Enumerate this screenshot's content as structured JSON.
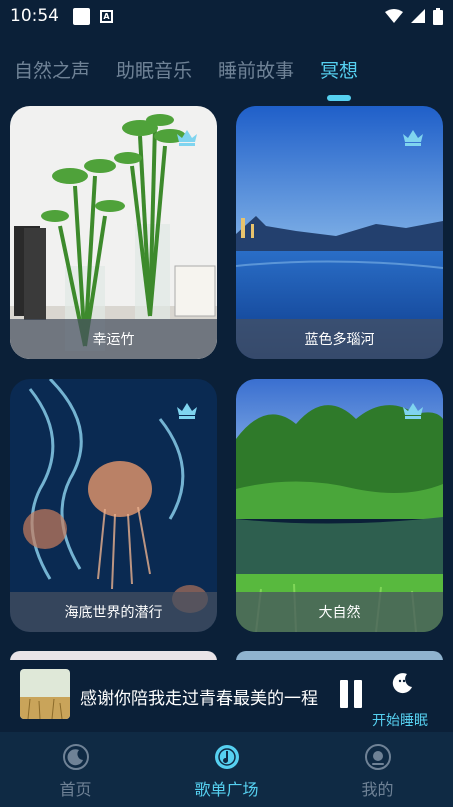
{
  "status_bar": {
    "time": "10:54"
  },
  "tabs": [
    {
      "label": "自然之声",
      "active": false
    },
    {
      "label": "助眠音乐",
      "active": false
    },
    {
      "label": "睡前故事",
      "active": false
    },
    {
      "label": "冥想",
      "active": true
    }
  ],
  "cards": [
    {
      "label": "幸运竹",
      "premium": true
    },
    {
      "label": "蓝色多瑙河",
      "premium": true
    },
    {
      "label": "海底世界的潜行",
      "premium": true
    },
    {
      "label": "大自然",
      "premium": true
    }
  ],
  "player": {
    "song_title": "感谢你陪我走过青春最美的一程",
    "sleep_label": "开始睡眠"
  },
  "bottom_nav": [
    {
      "label": "首页",
      "active": false
    },
    {
      "label": "歌单广场",
      "active": true
    },
    {
      "label": "我的",
      "active": false
    }
  ],
  "colors": {
    "accent": "#56d0f0",
    "background": "#0b2038",
    "inactive": "#6f8296"
  }
}
